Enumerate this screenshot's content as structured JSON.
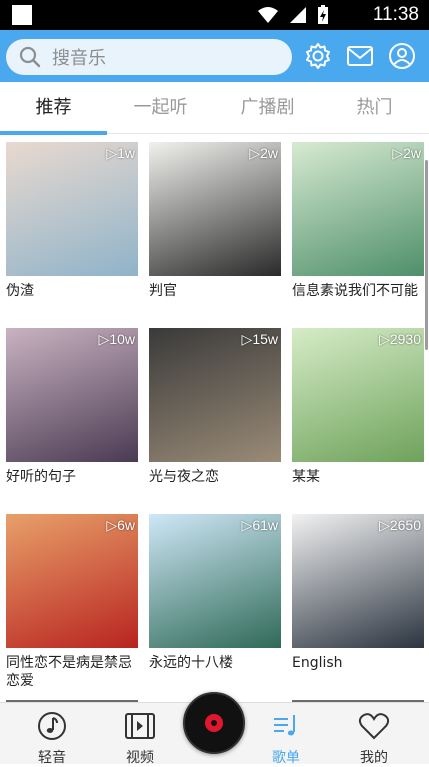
{
  "status": {
    "time": "11:38"
  },
  "search": {
    "placeholder": "搜音乐"
  },
  "tabs": [
    {
      "label": "推荐",
      "active": true
    },
    {
      "label": "一起听",
      "active": false
    },
    {
      "label": "广播剧",
      "active": false
    },
    {
      "label": "热门",
      "active": false
    }
  ],
  "playlists": [
    {
      "title": "伪渣",
      "plays": "▷1w",
      "colors": [
        "#e9d9cf",
        "#8fb3c9"
      ]
    },
    {
      "title": "判官",
      "plays": "▷2w",
      "colors": [
        "#f1f1ee",
        "#2a2a2a"
      ]
    },
    {
      "title": "信息素说我们不可能",
      "plays": "▷2w",
      "colors": [
        "#d7ead2",
        "#4e8f6a"
      ]
    },
    {
      "title": "好听的句子",
      "plays": "▷10w",
      "colors": [
        "#c9b3c2",
        "#4a3a52"
      ]
    },
    {
      "title": "光与夜之恋",
      "plays": "▷15w",
      "colors": [
        "#3a3a3a",
        "#9a8b77"
      ]
    },
    {
      "title": "某某",
      "plays": "▷2930",
      "colors": [
        "#d6ecc7",
        "#6ea25b"
      ]
    },
    {
      "title": "同性恋不是病是禁忌恋爱",
      "plays": "▷6w",
      "colors": [
        "#e8a06a",
        "#b82420"
      ]
    },
    {
      "title": "永远的十八楼",
      "plays": "▷61w",
      "colors": [
        "#cfe7f7",
        "#2f6a57"
      ]
    },
    {
      "title": "English",
      "plays": "▷2650",
      "colors": [
        "#f2f2f2",
        "#2b3440"
      ]
    }
  ],
  "nav": [
    {
      "label": "轻音",
      "icon": "music-note-icon",
      "active": false
    },
    {
      "label": "视频",
      "icon": "video-film-icon",
      "active": false
    },
    {
      "label": "歌单",
      "icon": "playlist-icon",
      "active": true
    },
    {
      "label": "我的",
      "icon": "heart-icon",
      "active": false
    }
  ],
  "colors": {
    "accent": "#4aa8ee",
    "header": "#4aa8ee"
  }
}
